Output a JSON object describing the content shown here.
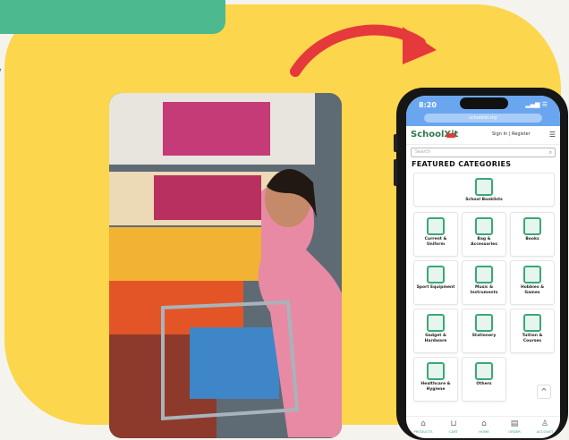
{
  "phone": {
    "status_time": "8:20",
    "status_icons": "▂▄▆ ☰",
    "url": "schoolist.my",
    "logo": "SchoolXit",
    "sign_in": "Sign In | Register",
    "search_placeholder": "Search",
    "section_title": "FEATURED CATEGORIES",
    "categories": [
      {
        "label": "School Booklists"
      },
      {
        "label": "Current & Uniform"
      },
      {
        "label": "Bag & Accessories"
      },
      {
        "label": "Books"
      },
      {
        "label": "Sport Equipment"
      },
      {
        "label": "Music & Instruments"
      },
      {
        "label": "Hobbies & Games"
      },
      {
        "label": "Gadget & Hardware"
      },
      {
        "label": "Stationery"
      },
      {
        "label": "Tuition & Courses"
      },
      {
        "label": "Healthcare & Hygiene"
      },
      {
        "label": "Others"
      }
    ],
    "tabs": [
      "PRODUCTS",
      "CART",
      "HOME",
      "ORDER",
      "ACCOUNT"
    ],
    "scroll_top": "^"
  },
  "colors": {
    "background_blob": "#fcd64d",
    "accent_teal": "#4db98f",
    "arrow_red": "#e5393b",
    "brand_green": "#3aa876"
  }
}
